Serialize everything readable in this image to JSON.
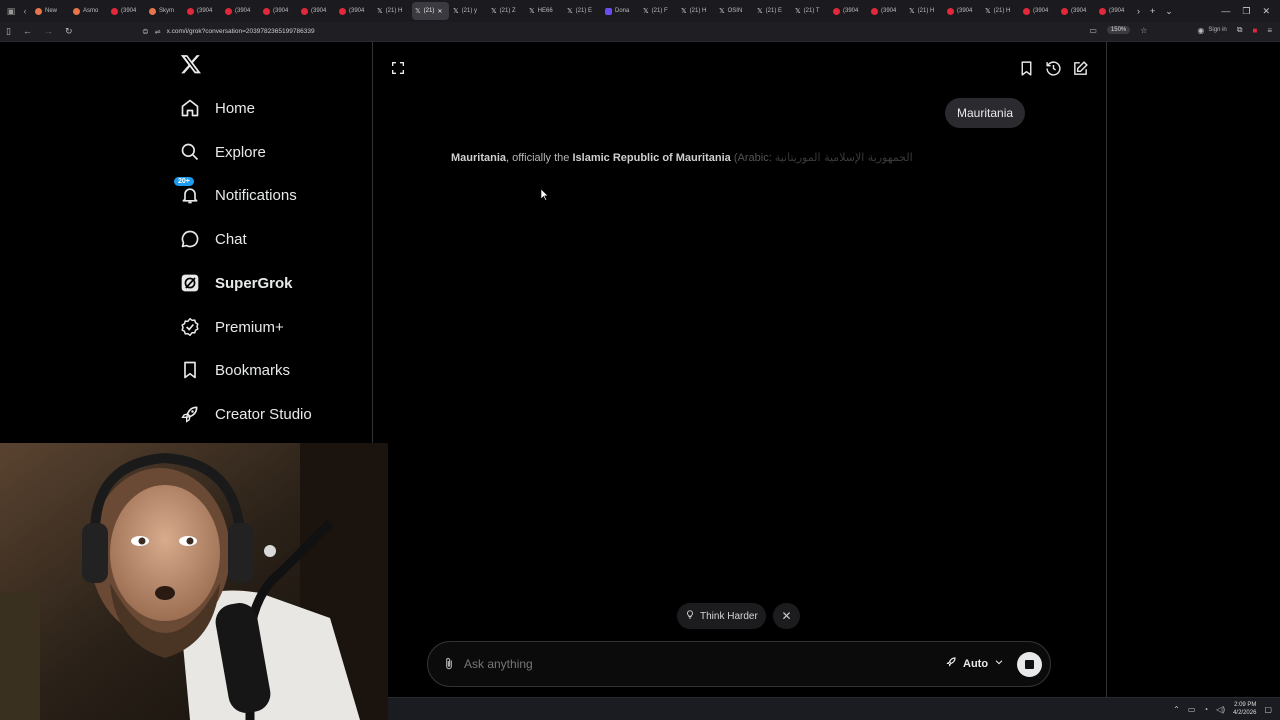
{
  "browser": {
    "tabs": [
      {
        "label": "New",
        "fav": "ora"
      },
      {
        "label": "Asmo",
        "fav": "ora"
      },
      {
        "label": "(3904",
        "fav": "red"
      },
      {
        "label": "Skym",
        "fav": "ora"
      },
      {
        "label": "(3904",
        "fav": "red"
      },
      {
        "label": "(3904",
        "fav": "red"
      },
      {
        "label": "(3904",
        "fav": "red"
      },
      {
        "label": "(3904",
        "fav": "red"
      },
      {
        "label": "(3904",
        "fav": "red"
      },
      {
        "label": "(21) H",
        "fav": "x"
      },
      {
        "label": "(21)",
        "fav": "x",
        "active": true
      },
      {
        "label": "(21) y",
        "fav": "x"
      },
      {
        "label": "(21) Z",
        "fav": "x"
      },
      {
        "label": "HE66",
        "fav": "x"
      },
      {
        "label": "(21) E",
        "fav": "x"
      },
      {
        "label": "Dona",
        "fav": "purple"
      },
      {
        "label": "(21) F",
        "fav": "x"
      },
      {
        "label": "(21) H",
        "fav": "x"
      },
      {
        "label": "OSIN",
        "fav": "x"
      },
      {
        "label": "(21) E",
        "fav": "x"
      },
      {
        "label": "(21) T",
        "fav": "x"
      },
      {
        "label": "(3904",
        "fav": "red"
      },
      {
        "label": "(3904",
        "fav": "red"
      },
      {
        "label": "(21) H",
        "fav": "x"
      },
      {
        "label": "(3904",
        "fav": "red"
      },
      {
        "label": "(21) H",
        "fav": "x"
      },
      {
        "label": "(3904",
        "fav": "red"
      },
      {
        "label": "(3904",
        "fav": "red"
      },
      {
        "label": "(3904",
        "fav": "red"
      }
    ],
    "url": "x.com/i/grok?conversation=2039782365199786339",
    "zoom": "150%",
    "sign_in": "Sign in"
  },
  "sidebar": {
    "items": [
      {
        "label": "Home",
        "icon": "home-icon"
      },
      {
        "label": "Explore",
        "icon": "search-icon"
      },
      {
        "label": "Notifications",
        "icon": "bell-icon",
        "badge": "20+"
      },
      {
        "label": "Chat",
        "icon": "chat-icon"
      },
      {
        "label": "SuperGrok",
        "icon": "grok-icon"
      },
      {
        "label": "Premium+",
        "icon": "verified-icon"
      },
      {
        "label": "Bookmarks",
        "icon": "bookmark-icon"
      },
      {
        "label": "Creator Studio",
        "icon": "rocket-icon"
      }
    ]
  },
  "grok": {
    "user_message": "Mauritania",
    "answer": {
      "bold1": "Mauritania",
      "part1": ", officially the ",
      "bold2": "Islamic Republic of Mauritania",
      "part2": " (Arabic: ",
      "arabic": "الجمهورية الإسلامية الموريتانية"
    },
    "think_harder": "Think Harder",
    "composer": {
      "placeholder": "Ask anything",
      "mode": "Auto"
    }
  },
  "taskbar": {
    "time": "2:09 PM",
    "date": "4/2/2026"
  }
}
